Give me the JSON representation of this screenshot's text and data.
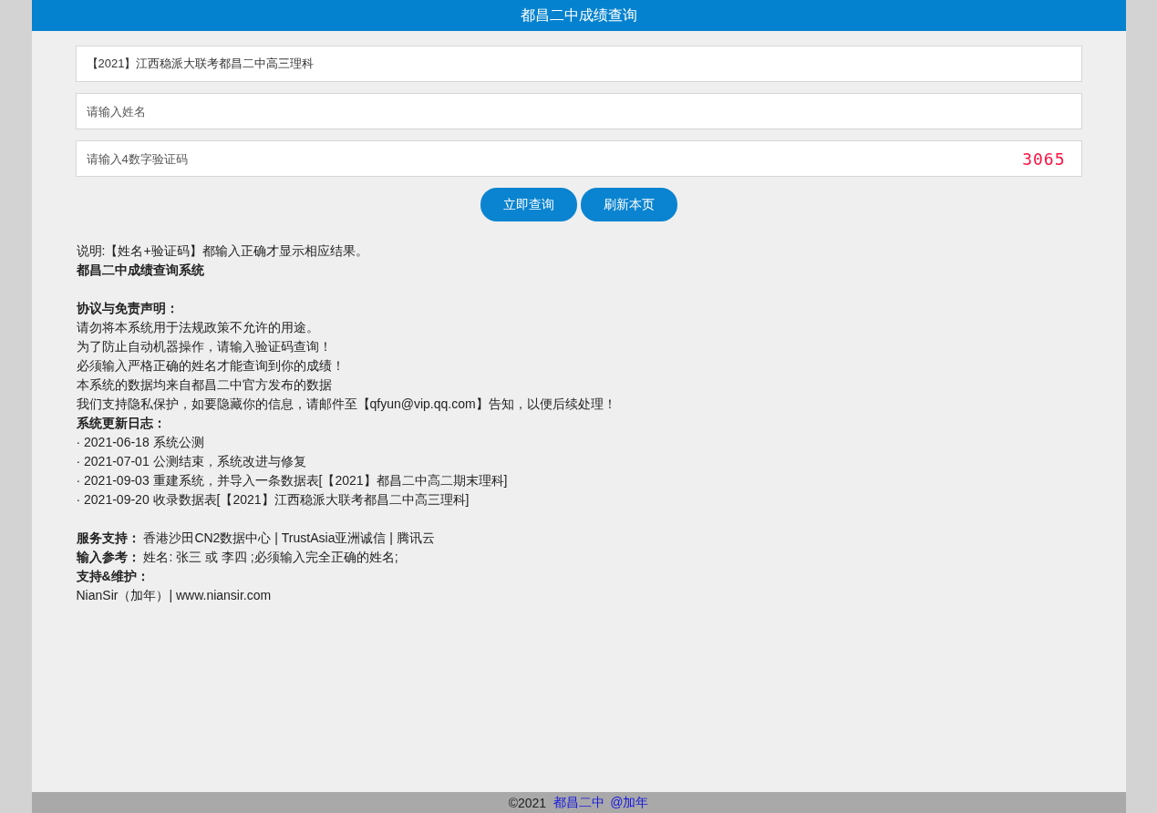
{
  "header": {
    "title": "都昌二中成绩查询"
  },
  "form": {
    "exam_field": {
      "value": "【2021】江西稳派大联考都昌二中高三理科"
    },
    "name_field": {
      "placeholder": "请输入姓名"
    },
    "code_field": {
      "placeholder": "请输入4数字验证码"
    },
    "captcha": {
      "text": "3065"
    },
    "buttons": [
      {
        "label": "立即查询"
      },
      {
        "label": "刷新本页"
      }
    ]
  },
  "note": "说明:【姓名+验证码】都输入正确才显示相应结果。",
  "sections": [
    {
      "lines": [
        {
          "kind": "heading",
          "text": "都昌二中成绩查询系统"
        }
      ]
    },
    {
      "lines": [
        {
          "kind": "heading",
          "text": "协议与免责声明："
        },
        {
          "kind": "plain",
          "text": "请勿将本系统用于法规政策不允许的用途。"
        },
        {
          "kind": "plain",
          "text": "为了防止自动机器操作，请输入验证码查询！"
        },
        {
          "kind": "plain",
          "text": "必须输入严格正确的姓名才能查询到你的成绩！"
        },
        {
          "kind": "plain",
          "text": "本系统的数据均来自都昌二中官方发布的数据"
        },
        {
          "kind": "plain",
          "text": "我们支持隐私保护，如要隐藏你的信息，请邮件至【qfyun@vip.qq.com】告知，以便后续处理！"
        },
        {
          "kind": "heading",
          "text": "系统更新日志："
        },
        {
          "kind": "plain",
          "text": "· 2021-06-18 系统公测"
        },
        {
          "kind": "plain",
          "text": "· 2021-07-01 公测结束，系统改进与修复"
        },
        {
          "kind": "plain",
          "text": "· 2021-09-03 重建系统，并导入一条数据表[【2021】都昌二中高二期末理科]"
        },
        {
          "kind": "plain",
          "text": "· 2021-09-20 收录数据表[【2021】江西稳派大联考都昌二中高三理科]"
        }
      ]
    },
    {
      "lines": [
        {
          "kind": "labeled",
          "label": "服务支持：",
          "text": "香港沙田CN2数据中心 | TrustAsia亚洲诚信 | 腾讯云"
        },
        {
          "kind": "labeled",
          "label": "输入参考：",
          "text": "姓名: 张三 或 李四 ;必须输入完全正确的姓名;"
        },
        {
          "kind": "heading",
          "text": "支持&维护："
        },
        {
          "kind": "plain",
          "text": "NianSir（加年）| www.niansir.com"
        }
      ]
    }
  ],
  "footer": {
    "copyright": "©2021",
    "links": [
      "都昌二中",
      "@加年"
    ]
  }
}
